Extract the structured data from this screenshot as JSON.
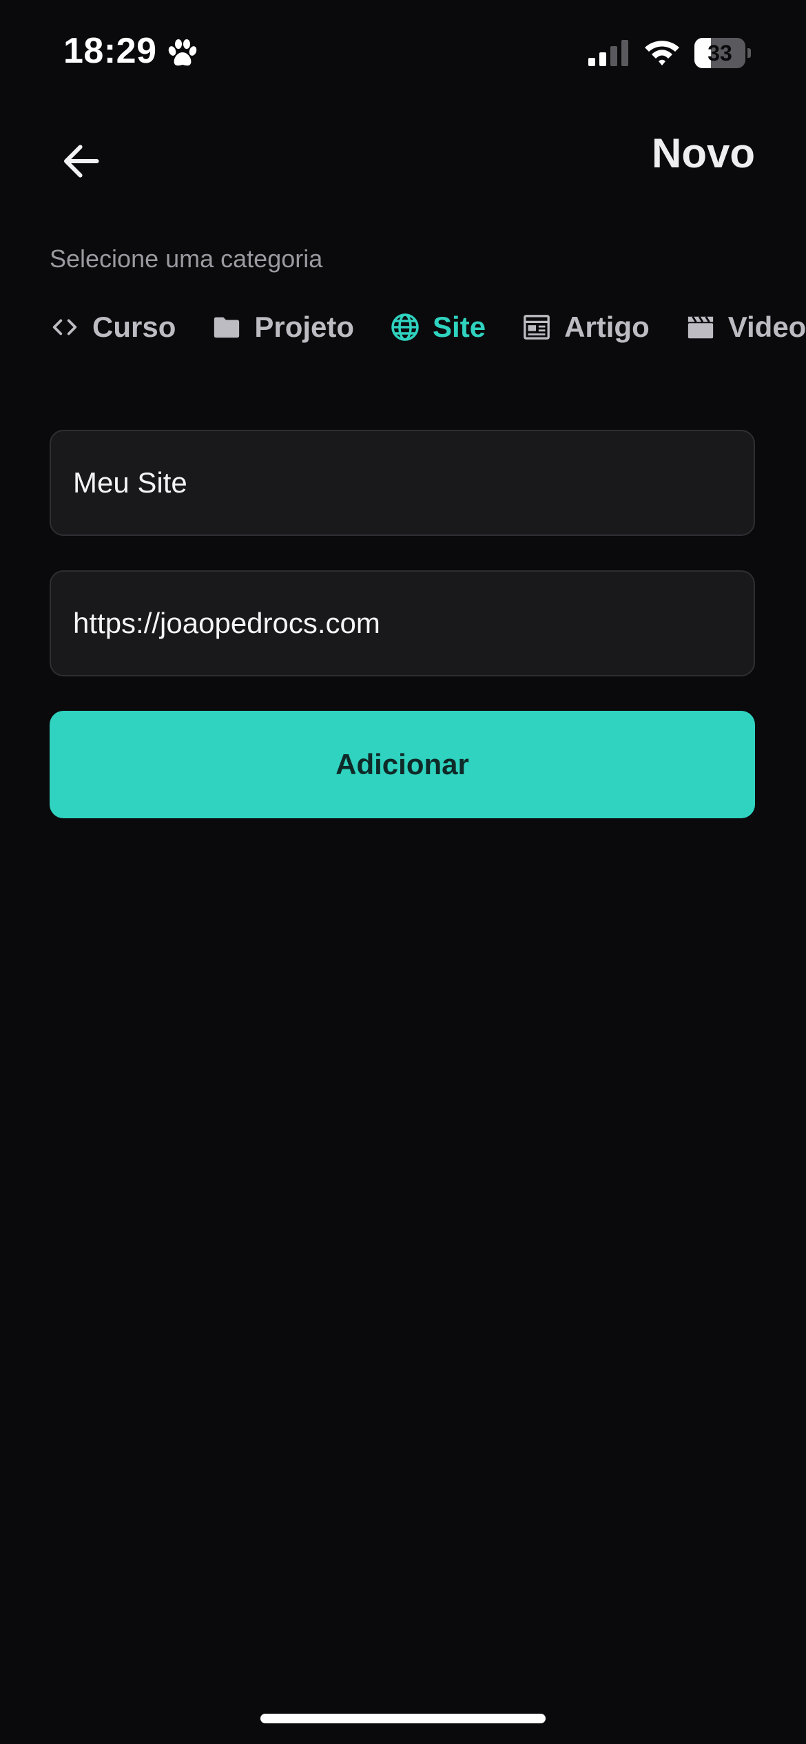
{
  "status_bar": {
    "time": "18:29",
    "battery_level": "33",
    "battery_fraction": 0.33
  },
  "header": {
    "title": "Novo",
    "back_icon": "arrow-left-icon"
  },
  "category": {
    "label": "Selecione uma categoria",
    "items": [
      {
        "label": "Curso",
        "icon": "code-icon",
        "active": false
      },
      {
        "label": "Projeto",
        "icon": "folder-icon",
        "active": false
      },
      {
        "label": "Site",
        "icon": "globe-icon",
        "active": true
      },
      {
        "label": "Artigo",
        "icon": "article-icon",
        "active": false
      },
      {
        "label": "Video",
        "icon": "clapperboard-icon",
        "active": false
      }
    ]
  },
  "form": {
    "name_value": "Meu Site",
    "url_value": "https://joaopedrocs.com",
    "submit_label": "Adicionar"
  },
  "colors": {
    "background": "#0a0a0c",
    "accent": "#2fd3bf",
    "field_background": "#19191c",
    "muted_text": "#9a9aa0"
  }
}
